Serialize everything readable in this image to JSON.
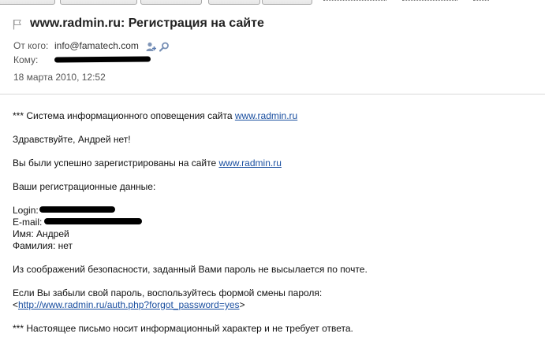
{
  "toolbar": {
    "buttons": [
      "",
      "",
      "",
      "",
      ""
    ]
  },
  "message": {
    "subject": "www.radmin.ru: Регистрация на сайте",
    "from_label": "От кого:",
    "from_value": "info@famatech.com",
    "to_label": "Кому:",
    "date": "18 марта 2010, 12:52"
  },
  "body": {
    "line1_prefix": "*** Система информационного оповещения сайта ",
    "line1_link": "www.radmin.ru",
    "greeting": "Здравствуйте, Андрей нет!",
    "registered_prefix": "Вы были успешно зарегистрированы на сайте ",
    "registered_link": "www.radmin.ru",
    "data_heading": "Ваши регистрационные данные:",
    "login_label": "Login:",
    "email_label": "E-mail:",
    "name_line": "Имя: Андрей",
    "surname_line": "Фамилия: нет",
    "security_note": "Из соображений безопасности, заданный Вами пароль не высылается по почте.",
    "forgot_line": "Если Вы забыли свой пароль, воспользуйтесь формой смены пароля:",
    "forgot_open": "<",
    "forgot_link": "http://www.radmin.ru/auth.php?forgot_password=yes",
    "forgot_close": ">",
    "footer": "*** Настоящее письмо носит информационный характер и не требует ответа."
  }
}
